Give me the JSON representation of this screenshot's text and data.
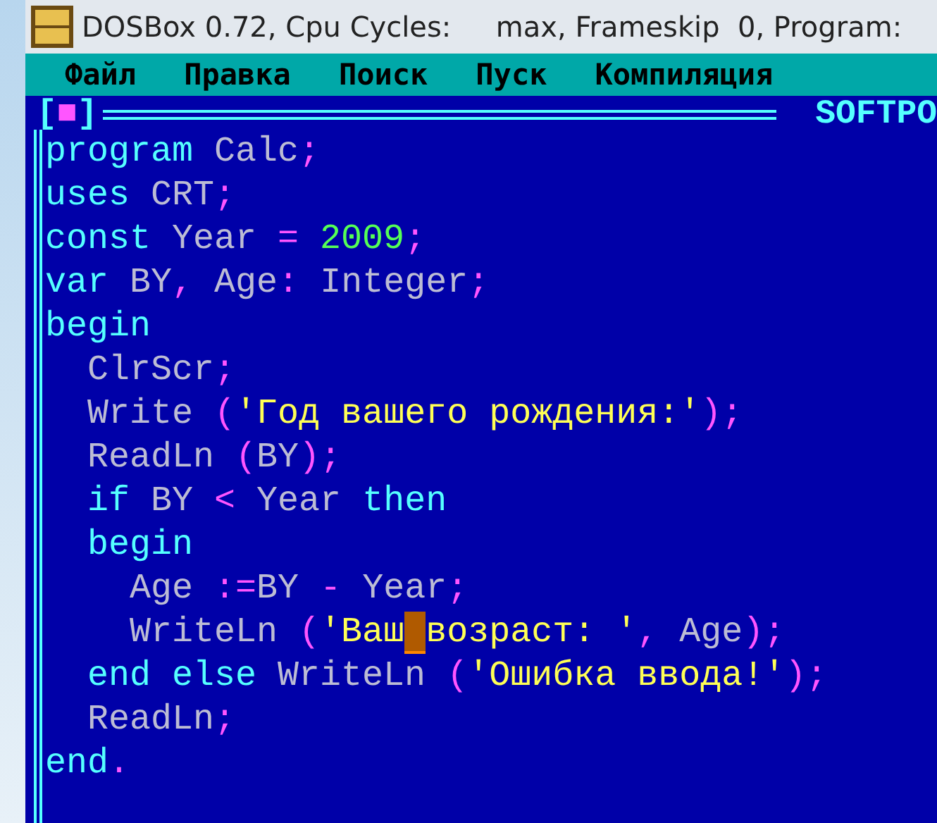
{
  "window": {
    "title": "DOSBox 0.72, Cpu Cycles:     max, Frameskip  0, Program:"
  },
  "menu": [
    "Файл",
    "Правка",
    "Поиск",
    "Пуск",
    "Компиляция"
  ],
  "editor": {
    "close_button": {
      "open": "[",
      "glyph": "■",
      "close": "]"
    },
    "title": "SOFTPO",
    "lines": [
      [
        {
          "text": "program",
          "kind": "keyword"
        },
        {
          "text": " Calc",
          "kind": "ident"
        },
        {
          "text": ";",
          "kind": "punct"
        }
      ],
      [
        {
          "text": "uses",
          "kind": "keyword"
        },
        {
          "text": " CRT",
          "kind": "ident"
        },
        {
          "text": ";",
          "kind": "punct"
        }
      ],
      [
        {
          "text": "const",
          "kind": "keyword"
        },
        {
          "text": " Year ",
          "kind": "ident"
        },
        {
          "text": "= ",
          "kind": "punct"
        },
        {
          "text": "2009",
          "kind": "number"
        },
        {
          "text": ";",
          "kind": "punct"
        }
      ],
      [
        {
          "text": "var",
          "kind": "keyword"
        },
        {
          "text": " BY",
          "kind": "ident"
        },
        {
          "text": ", ",
          "kind": "punct"
        },
        {
          "text": "Age",
          "kind": "ident"
        },
        {
          "text": ": ",
          "kind": "punct"
        },
        {
          "text": "Integer",
          "kind": "ident"
        },
        {
          "text": ";",
          "kind": "punct"
        }
      ],
      [
        {
          "text": "begin",
          "kind": "keyword"
        }
      ],
      [
        {
          "text": "  ClrScr",
          "kind": "ident"
        },
        {
          "text": ";",
          "kind": "punct"
        }
      ],
      [
        {
          "text": "  Write ",
          "kind": "ident"
        },
        {
          "text": "(",
          "kind": "punct"
        },
        {
          "text": "'Год вашего рождения:'",
          "kind": "string"
        },
        {
          "text": ");",
          "kind": "punct"
        }
      ],
      [
        {
          "text": "  ReadLn ",
          "kind": "ident"
        },
        {
          "text": "(",
          "kind": "punct"
        },
        {
          "text": "BY",
          "kind": "ident"
        },
        {
          "text": ");",
          "kind": "punct"
        }
      ],
      [
        {
          "text": "  if",
          "kind": "keyword"
        },
        {
          "text": " BY ",
          "kind": "ident"
        },
        {
          "text": "< ",
          "kind": "punct"
        },
        {
          "text": "Year ",
          "kind": "ident"
        },
        {
          "text": "then",
          "kind": "keyword"
        }
      ],
      [
        {
          "text": "  begin",
          "kind": "keyword"
        }
      ],
      [
        {
          "text": "    Age ",
          "kind": "ident"
        },
        {
          "text": ":=",
          "kind": "punct"
        },
        {
          "text": "BY ",
          "kind": "ident"
        },
        {
          "text": "- ",
          "kind": "punct"
        },
        {
          "text": "Year",
          "kind": "ident"
        },
        {
          "text": ";",
          "kind": "punct"
        }
      ],
      [
        {
          "text": "    WriteLn ",
          "kind": "ident"
        },
        {
          "text": "(",
          "kind": "punct"
        },
        {
          "text": "'Ваш",
          "kind": "string"
        },
        {
          "kind": "cursor"
        },
        {
          "text": "возраст: '",
          "kind": "string"
        },
        {
          "text": ", ",
          "kind": "punct"
        },
        {
          "text": "Age",
          "kind": "ident"
        },
        {
          "text": ");",
          "kind": "punct"
        }
      ],
      [
        {
          "text": "  end else",
          "kind": "keyword"
        },
        {
          "text": " WriteLn ",
          "kind": "ident"
        },
        {
          "text": "(",
          "kind": "punct"
        },
        {
          "text": "'Ошибка ввода!'",
          "kind": "string"
        },
        {
          "text": ");",
          "kind": "punct"
        }
      ],
      [
        {
          "text": "  ReadLn",
          "kind": "ident"
        },
        {
          "text": ";",
          "kind": "punct"
        }
      ],
      [
        {
          "text": "end",
          "kind": "keyword"
        },
        {
          "text": ".",
          "kind": "punct"
        }
      ]
    ]
  }
}
